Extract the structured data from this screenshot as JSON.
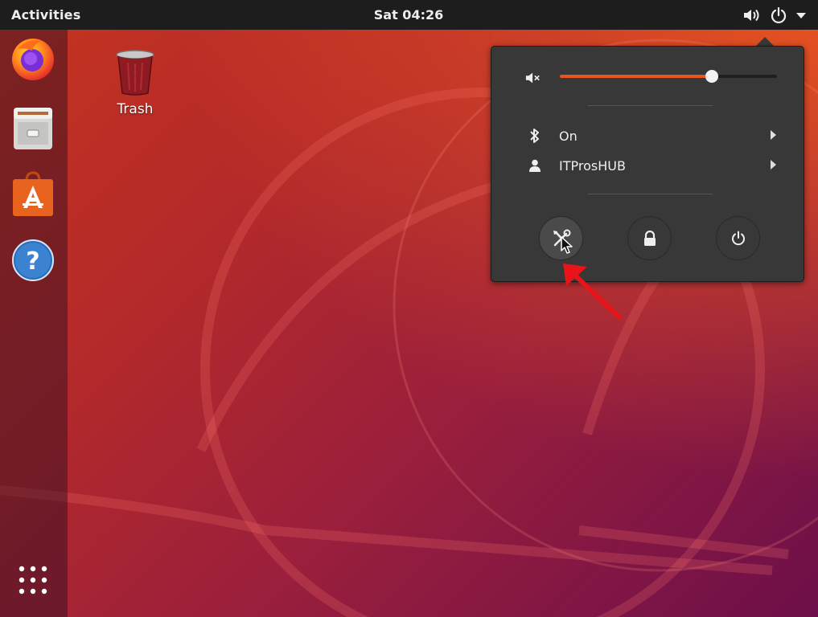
{
  "topbar": {
    "activities": "Activities",
    "clock": "Sat 04:26"
  },
  "tray": {
    "icons": [
      "volume-icon",
      "power-icon",
      "dropdown-arrow-icon"
    ]
  },
  "dock": {
    "items": [
      "firefox",
      "files",
      "ubuntu-software",
      "help"
    ],
    "show_apps": "app-grid-icon"
  },
  "desktop": {
    "trash_label": "Trash"
  },
  "menu": {
    "volume_level": 0.7,
    "bluetooth_label": "On",
    "user_label": "ITProsHUB",
    "buttons": [
      "settings-icon",
      "lock-icon",
      "power-off-icon"
    ]
  },
  "colors": {
    "accent": "#e95420",
    "menu_bg": "#383838",
    "topbar_bg": "#1d1d1d"
  }
}
